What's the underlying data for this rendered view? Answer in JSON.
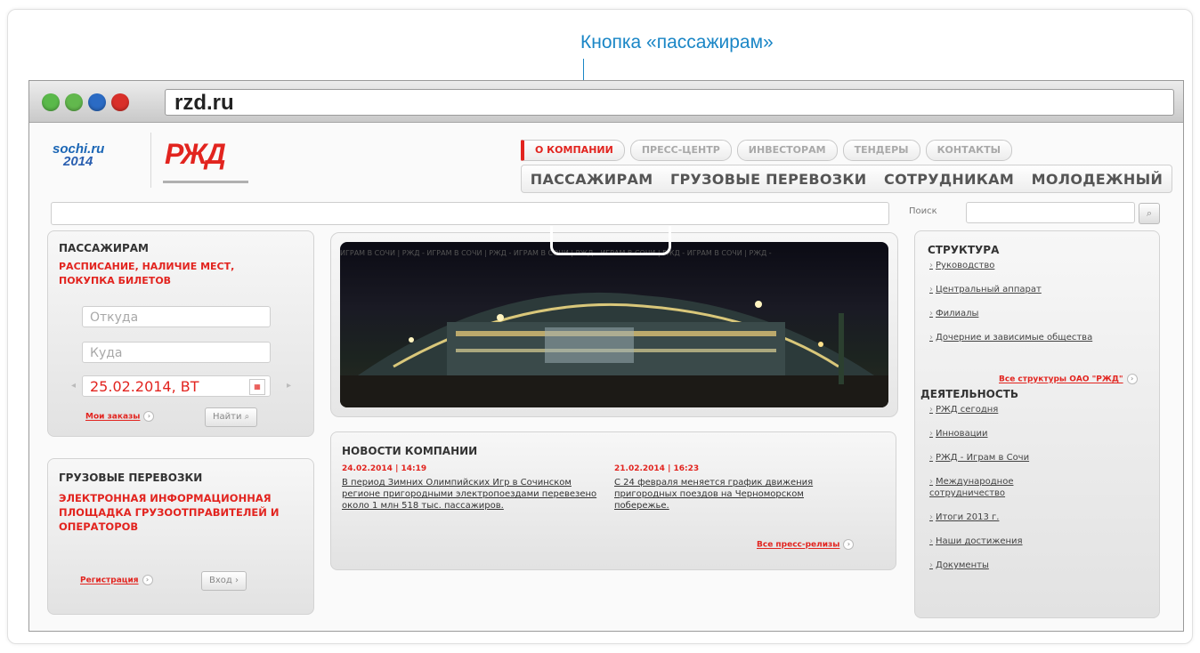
{
  "callout": {
    "text": "Кнопка «пассажирам»"
  },
  "browser": {
    "url": "rzd.ru"
  },
  "header": {
    "sochi_logo_line1": "sochi.ru",
    "sochi_logo_line2": "2014",
    "rzd_logo": "РЖД",
    "top_nav": [
      "О КОМПАНИИ",
      "ПРЕСС-ЦЕНТР",
      "ИНВЕСТОРАМ",
      "ТЕНДЕРЫ",
      "КОНТАКТЫ"
    ],
    "main_nav": [
      "ПАССАЖИРАМ",
      "ГРУЗОВЫЕ ПЕРЕВОЗКИ",
      "СОТРУДНИКАМ",
      "МОЛОДЕЖНЫЙ"
    ]
  },
  "search": {
    "label": "Поиск"
  },
  "passengers": {
    "title": "ПАССАЖИРАМ",
    "subtitle": "РАСПИСАНИЕ, НАЛИЧИЕ МЕСТ, ПОКУПКА БИЛЕТОВ",
    "from_placeholder": "Откуда",
    "to_placeholder": "Куда",
    "date": "25.02.2014, ВТ",
    "my_orders": "Мои заказы",
    "find": "Найти"
  },
  "cargo": {
    "title": "ГРУЗОВЫЕ ПЕРЕВОЗКИ",
    "subtitle": "ЭЛЕКТРОННАЯ ИНФОРМАЦИОННАЯ ПЛОЩАДКА ГРУЗООТПРАВИТЕЛЕЙ И ОПЕРАТОРОВ",
    "register": "Регистрация",
    "login": "Вход"
  },
  "banner": {
    "strip_text": "ИГРАМ В СОЧИ | РЖД - ИГРАМ В СОЧИ | РЖД - ИГРАМ В СОЧИ | РЖД - ИГРАМ В СОЧИ | РЖД - ИГРАМ В СОЧИ | РЖД -"
  },
  "news": {
    "title": "НОВОСТИ КОМПАНИИ",
    "items": [
      {
        "date": "24.02.2014 | 14:19",
        "text": "В период Зимних Олимпийских Игр в Сочинском регионе пригородными электропоездами перевезено около 1 млн 518 тыс. пассажиров."
      },
      {
        "date": "21.02.2014 | 16:23",
        "text": "С 24 февраля меняется график движения пригородных поездов на Черноморском побережье."
      }
    ],
    "all_link": "Все пресс-релизы"
  },
  "structure": {
    "title": "СТРУКТУРА",
    "links": [
      "Руководство",
      "Центральный аппарат",
      "Филиалы",
      "Дочерние и зависимые общества"
    ],
    "all_link": "Все структуры ОАО \"РЖД\""
  },
  "activity": {
    "title": "ДЕЯТЕЛЬНОСТЬ",
    "links": [
      "РЖД сегодня",
      "Инновации",
      "РЖД - Играм в Сочи",
      "Международное сотрудничество",
      "Итоги 2013 г.",
      "Наши достижения",
      "Документы"
    ]
  },
  "colors": {
    "accent": "#e2241f",
    "callout": "#1a86c6",
    "sochi_blue": "#1b66b5"
  }
}
